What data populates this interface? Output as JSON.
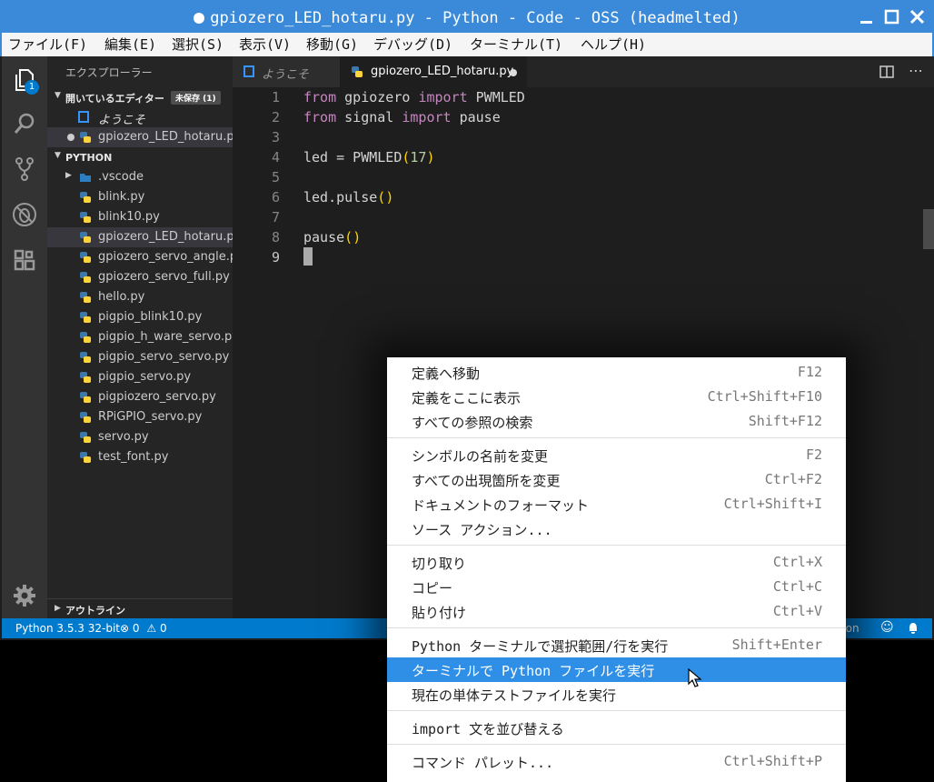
{
  "window": {
    "title": "gpiozero_LED_hotaru.py - Python - Code - OSS (headmelted)"
  },
  "menubar": [
    "ファイル(F)",
    "編集(E)",
    "選択(S)",
    "表示(V)",
    "移動(G)",
    "デバッグ(D)",
    "ターミナル(T)",
    "ヘルプ(H)"
  ],
  "activity": {
    "badge": "1"
  },
  "sidebar": {
    "title": "エクスプローラー",
    "open_editors": {
      "label": "開いているエディター",
      "badge": "未保存 (1)",
      "items": [
        {
          "name": "ようこそ"
        },
        {
          "name": "gpiozero_LED_hotaru.py"
        }
      ]
    },
    "project": {
      "label": "PYTHON",
      "folder": ".vscode",
      "files": [
        "blink.py",
        "blink10.py",
        "gpiozero_LED_hotaru.py",
        "gpiozero_servo_angle.py",
        "gpiozero_servo_full.py",
        "hello.py",
        "pigpio_blink10.py",
        "pigpio_h_ware_servo.py",
        "pigpio_servo_servo.py",
        "pigpio_servo.py",
        "pigpiozero_servo.py",
        "RPiGPIO_servo.py",
        "servo.py",
        "test_font.py"
      ]
    },
    "outline": "アウトライン"
  },
  "tabs": [
    {
      "label": "ようこそ"
    },
    {
      "label": "gpiozero_LED_hotaru.py"
    }
  ],
  "editor": {
    "line_numbers": [
      "1",
      "2",
      "3",
      "4",
      "5",
      "6",
      "7",
      "8",
      "9"
    ],
    "lines": [
      {
        "k1": "from",
        "t1": " gpiozero ",
        "k2": "import",
        "t2": " PWMLED"
      },
      {
        "k1": "from",
        "t1": " signal ",
        "k2": "import",
        "t2": " pause"
      },
      {
        "t": ""
      },
      {
        "a": "led = PWMLED",
        "b1": "(",
        "n": "17",
        "b2": ")"
      },
      {
        "t": ""
      },
      {
        "a": "led.pulse",
        "b1": "(",
        "b2": ")"
      },
      {
        "t": ""
      },
      {
        "a": "pause",
        "b1": "(",
        "b2": ")"
      },
      {
        "t": ""
      }
    ]
  },
  "statusbar": {
    "interpreter": "Python 3.5.3 32-bit",
    "errors": "0",
    "warnings": "0",
    "language": "Python"
  },
  "context_menu": {
    "groups": [
      [
        {
          "label": "定義へ移動",
          "shortcut": "F12"
        },
        {
          "label": "定義をここに表示",
          "shortcut": "Ctrl+Shift+F10"
        },
        {
          "label": "すべての参照の検索",
          "shortcut": "Shift+F12"
        }
      ],
      [
        {
          "label": "シンボルの名前を変更",
          "shortcut": "F2"
        },
        {
          "label": "すべての出現箇所を変更",
          "shortcut": "Ctrl+F2"
        },
        {
          "label": "ドキュメントのフォーマット",
          "shortcut": "Ctrl+Shift+I"
        },
        {
          "label": "ソース アクション...",
          "shortcut": ""
        }
      ],
      [
        {
          "label": "切り取り",
          "shortcut": "Ctrl+X"
        },
        {
          "label": "コピー",
          "shortcut": "Ctrl+C"
        },
        {
          "label": "貼り付け",
          "shortcut": "Ctrl+V"
        }
      ],
      [
        {
          "label": "Python ターミナルで選択範囲/行を実行",
          "shortcut": "Shift+Enter"
        },
        {
          "label": "ターミナルで Python ファイルを実行",
          "shortcut": ""
        },
        {
          "label": "現在の単体テストファイルを実行",
          "shortcut": ""
        }
      ],
      [
        {
          "label": "import 文を並び替える",
          "shortcut": ""
        }
      ],
      [
        {
          "label": "コマンド パレット...",
          "shortcut": "Ctrl+Shift+P"
        }
      ]
    ]
  },
  "colors": {
    "titlebar": "#3a8ad9",
    "statusbar": "#007acc",
    "highlight": "#2f8fe6"
  }
}
